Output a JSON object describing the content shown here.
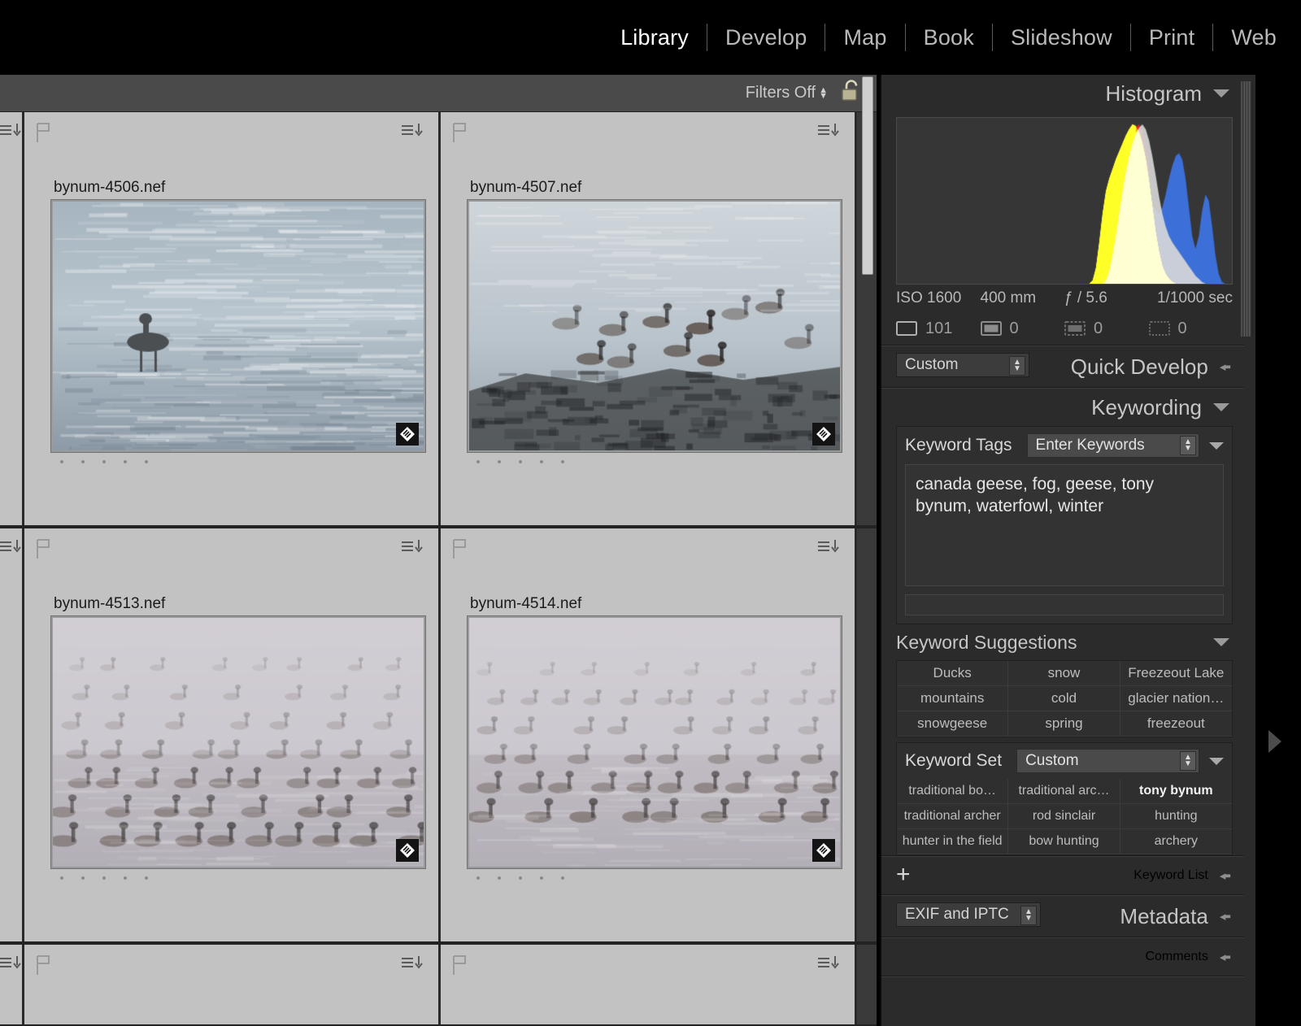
{
  "app": {
    "name": "Adobe Photoshop Lightroom",
    "module_active": "Library"
  },
  "topbar": {
    "modules": [
      {
        "label": "Library",
        "active": true
      },
      {
        "label": "Develop",
        "active": false
      },
      {
        "label": "Map",
        "active": false
      },
      {
        "label": "Book",
        "active": false
      },
      {
        "label": "Slideshow",
        "active": false
      },
      {
        "label": "Print",
        "active": false
      },
      {
        "label": "Web",
        "active": false
      }
    ]
  },
  "filterbar": {
    "filters_label": "Filters Off",
    "lock_icon": "unlocked-padlock-icon"
  },
  "grid": {
    "cells": [
      {
        "filename": "bynum-4506.nef",
        "rating_dots": 5,
        "flag": "unflagged",
        "badge": "keyword-tag-badge"
      },
      {
        "filename": "bynum-4507.nef",
        "rating_dots": 5,
        "flag": "unflagged",
        "badge": "keyword-tag-badge"
      },
      {
        "filename": "bynum-4513.nef",
        "rating_dots": 5,
        "flag": "unflagged",
        "badge": "keyword-tag-badge"
      },
      {
        "filename": "bynum-4514.nef",
        "rating_dots": 5,
        "flag": "unflagged",
        "badge": "keyword-tag-badge"
      }
    ]
  },
  "right_panel": {
    "histogram": {
      "title": "Histogram",
      "exif": {
        "iso": "ISO 1600",
        "focal": "400 mm",
        "aperture": "ƒ / 5.6",
        "shutter": "1/1000 sec"
      },
      "counts": [
        {
          "icon": "photo-frame-icon",
          "value": "101"
        },
        {
          "icon": "photo-filled-icon",
          "value": "0"
        },
        {
          "icon": "photo-dashed-icon",
          "value": "0"
        },
        {
          "icon": "photo-dotted-icon",
          "value": "0"
        }
      ]
    },
    "quick_develop": {
      "title": "Quick Develop",
      "preset": "Custom"
    },
    "keywording": {
      "title": "Keywording",
      "keyword_tags_label": "Keyword Tags",
      "keyword_mode": "Enter Keywords",
      "keywords_value": "canada geese, fog, geese, tony bynum, waterfowl, winter"
    },
    "keyword_suggestions": {
      "title": "Keyword Suggestions",
      "items": [
        "Ducks",
        "snow",
        "Freezeout Lake",
        "mountains",
        "cold",
        "glacier nation…",
        "snowgeese",
        "spring",
        "freezeout"
      ]
    },
    "keyword_set": {
      "title": "Keyword Set",
      "set_name": "Custom",
      "items": [
        {
          "label": "traditional bo…",
          "bold": false
        },
        {
          "label": "traditional arc…",
          "bold": false
        },
        {
          "label": "tony bynum",
          "bold": true
        },
        {
          "label": "traditional archer",
          "bold": false
        },
        {
          "label": "rod sinclair",
          "bold": false
        },
        {
          "label": "hunting",
          "bold": false
        },
        {
          "label": "hunter in the field",
          "bold": false
        },
        {
          "label": "bow hunting",
          "bold": false
        },
        {
          "label": "archery",
          "bold": false
        }
      ]
    },
    "keyword_list": {
      "title": "Keyword List",
      "add_label": "+"
    },
    "metadata": {
      "title": "Metadata",
      "preset": "EXIF and IPTC"
    },
    "comments": {
      "title": "Comments"
    }
  },
  "colors": {
    "topbar_bg": "#000000",
    "panel_bg": "#2b2b2b",
    "cell_bg": "#c2c2c2",
    "hist_red": "#e02020",
    "hist_yellow": "#f5e11a",
    "hist_blue": "#3d6fd8",
    "hist_gray": "#d8d8d8"
  },
  "chart_data": {
    "type": "area",
    "title": "Histogram",
    "xlabel": "",
    "ylabel": "",
    "legend": [
      "red",
      "yellow",
      "blue",
      "luminance"
    ],
    "series": [
      {
        "name": "yellow",
        "color": "#f5e11a",
        "values": [
          0,
          0,
          0,
          0,
          0,
          0,
          0,
          0,
          0,
          0,
          0,
          0,
          0,
          0,
          0,
          0,
          0,
          0,
          0,
          0,
          0,
          0,
          0,
          0,
          0,
          0,
          0,
          0,
          0,
          0,
          0,
          0,
          0,
          0,
          0,
          0,
          0,
          0,
          0,
          0,
          0,
          0,
          0,
          0,
          0,
          0,
          0,
          0,
          0,
          0,
          0,
          0,
          0,
          0,
          0,
          0,
          0,
          0,
          0,
          2,
          10,
          26,
          44,
          58,
          66,
          72,
          78,
          83,
          88,
          93,
          97,
          100,
          99,
          95,
          88,
          78,
          64,
          48,
          32,
          20,
          11,
          6,
          3,
          1,
          0,
          0,
          0,
          0,
          0,
          0,
          0,
          0,
          0,
          0,
          0,
          0,
          0,
          0,
          0,
          0
        ]
      },
      {
        "name": "luminance",
        "color": "#d8d8d8",
        "values": [
          0,
          0,
          0,
          0,
          0,
          0,
          0,
          0,
          0,
          0,
          0,
          0,
          0,
          0,
          0,
          0,
          0,
          0,
          0,
          0,
          0,
          0,
          0,
          0,
          0,
          0,
          0,
          0,
          0,
          0,
          0,
          0,
          0,
          0,
          0,
          0,
          0,
          0,
          0,
          0,
          0,
          0,
          0,
          0,
          0,
          0,
          0,
          0,
          0,
          0,
          0,
          0,
          0,
          0,
          0,
          0,
          0,
          0,
          0,
          0,
          0,
          0,
          0,
          2,
          8,
          18,
          30,
          44,
          58,
          70,
          80,
          88,
          94,
          98,
          100,
          97,
          90,
          80,
          68,
          55,
          44,
          36,
          30,
          26,
          23,
          20,
          17,
          14,
          11,
          8,
          5,
          3,
          1,
          0,
          0,
          0,
          0,
          0,
          0,
          0
        ]
      },
      {
        "name": "blue",
        "color": "#3d6fd8",
        "values": [
          0,
          0,
          0,
          0,
          0,
          0,
          0,
          0,
          0,
          0,
          0,
          0,
          0,
          0,
          0,
          0,
          0,
          0,
          0,
          0,
          0,
          0,
          0,
          0,
          0,
          0,
          0,
          0,
          0,
          0,
          0,
          0,
          0,
          0,
          0,
          0,
          0,
          0,
          0,
          0,
          0,
          0,
          0,
          0,
          0,
          0,
          0,
          0,
          0,
          0,
          0,
          0,
          0,
          0,
          0,
          0,
          0,
          0,
          0,
          0,
          0,
          0,
          0,
          0,
          0,
          0,
          0,
          0,
          0,
          2,
          20,
          52,
          78,
          90,
          84,
          70,
          58,
          50,
          46,
          44,
          48,
          56,
          66,
          74,
          80,
          82,
          78,
          66,
          48,
          30,
          22,
          30,
          46,
          56,
          52,
          36,
          18,
          6,
          1,
          0
        ]
      },
      {
        "name": "red",
        "color": "#e02020",
        "values": [
          0,
          0,
          0,
          0,
          0,
          0,
          0,
          0,
          0,
          0,
          0,
          0,
          0,
          0,
          0,
          0,
          0,
          0,
          0,
          0,
          0,
          0,
          0,
          0,
          0,
          0,
          0,
          0,
          0,
          0,
          0,
          0,
          0,
          0,
          0,
          0,
          0,
          0,
          0,
          0,
          0,
          0,
          0,
          0,
          0,
          0,
          0,
          0,
          0,
          0,
          0,
          0,
          0,
          0,
          0,
          0,
          0,
          0,
          0,
          0,
          0,
          0,
          0,
          0,
          0,
          0,
          0,
          0,
          0,
          0,
          0,
          0,
          98,
          100,
          96,
          88,
          70,
          44,
          20,
          8,
          3,
          1,
          0,
          0,
          0,
          0,
          0,
          0,
          0,
          0,
          0,
          0,
          0,
          0,
          0,
          0,
          0,
          0,
          0,
          0
        ]
      }
    ],
    "xlim": [
      0,
      255
    ],
    "ylim": [
      0,
      100
    ],
    "grid": false,
    "legend_position": "none"
  }
}
